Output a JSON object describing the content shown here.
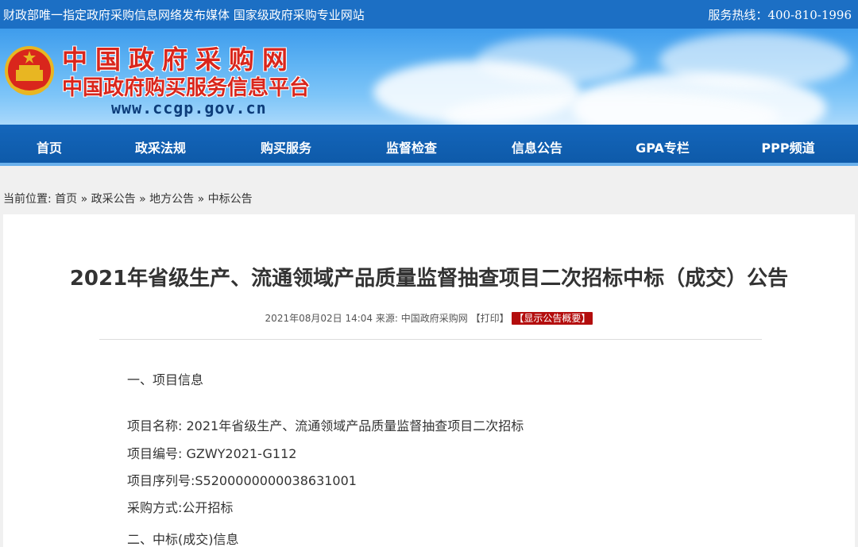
{
  "topbar": {
    "left_text": "财政部唯一指定政府采购信息网络发布媒体 国家级政府采购专业网站",
    "hotline": "服务热线：400-810-1996"
  },
  "logo": {
    "line1": "中国政府采购网",
    "line2": "中国政府购买服务信息平台",
    "url": "www.ccgp.gov.cn"
  },
  "nav": {
    "items": [
      "首页",
      "政采法规",
      "购买服务",
      "监督检查",
      "信息公告",
      "GPA专栏",
      "PPP频道"
    ]
  },
  "breadcrumb": {
    "prefix": "当前位置:",
    "items": [
      "首页",
      "政采公告",
      "地方公告",
      "中标公告"
    ],
    "sep": "»"
  },
  "article": {
    "title": "2021年省级生产、流通领域产品质量监督抽查项目二次招标中标（成交）公告",
    "date": "2021年08月02日 14:04",
    "source_label": "来源:",
    "source": "中国政府采购网",
    "print": "【打印】",
    "summary": "【显示公告概要】",
    "section1": "一、项目信息",
    "project_name": "项目名称: 2021年省级生产、流通领域产品质量监督抽查项目二次招标",
    "project_no": "项目编号: GZWY2021-G112",
    "project_serial": "项目序列号:S5200000000038631001",
    "procurement": "采购方式:公开招标",
    "section2": "二、中标(成交)信息"
  },
  "colors": {
    "topbar": "#1c6fc4",
    "nav": "#0e5aa9",
    "logo_red": "#d9261c",
    "summary_bg": "#b30d0d"
  }
}
